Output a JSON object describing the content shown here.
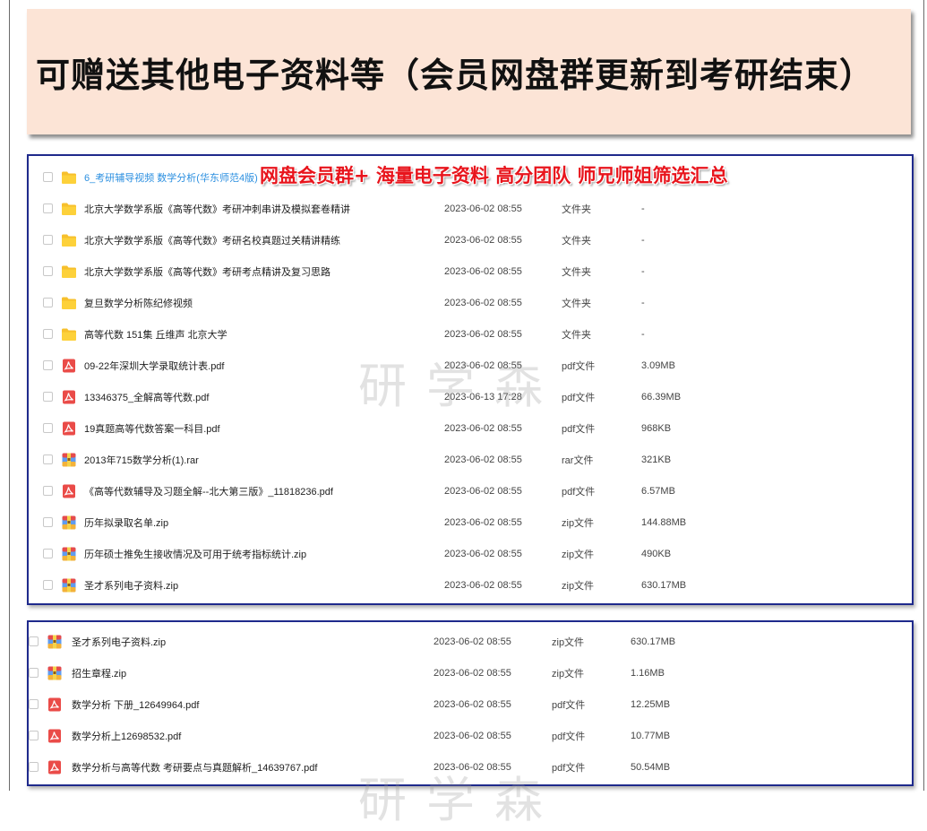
{
  "banner": {
    "title": "可赠送其他电子资料等（会员网盘群更新到考研结束）"
  },
  "overlay": {
    "promo": "网盘会员群+ 海量电子资料 高分团队 师兄师姐筛选汇总"
  },
  "watermark": {
    "text": "研学森"
  },
  "colors": {
    "panel_border": "#1f2a8c",
    "banner_bg": "#fce4d6",
    "promo_red": "#e8141c",
    "link_blue": "#2b8fe0"
  },
  "panel1": {
    "rows": [
      {
        "icon": "folder",
        "name": "6_考研辅导视频 数学分析(华东师范4版) 网",
        "date": "",
        "type": "",
        "size": ""
      },
      {
        "icon": "folder",
        "name": "北京大学数学系版《高等代数》考研冲刺串讲及模拟套卷精讲",
        "date": "2023-06-02 08:55",
        "type": "文件夹",
        "size": "-"
      },
      {
        "icon": "folder",
        "name": "北京大学数学系版《高等代数》考研名校真题过关精讲精练",
        "date": "2023-06-02 08:55",
        "type": "文件夹",
        "size": "-"
      },
      {
        "icon": "folder",
        "name": "北京大学数学系版《高等代数》考研考点精讲及复习思路",
        "date": "2023-06-02 08:55",
        "type": "文件夹",
        "size": "-"
      },
      {
        "icon": "folder",
        "name": "复旦数学分析陈纪修视频",
        "date": "2023-06-02 08:55",
        "type": "文件夹",
        "size": "-"
      },
      {
        "icon": "folder",
        "name": "高等代数 151集 丘维声 北京大学",
        "date": "2023-06-02 08:55",
        "type": "文件夹",
        "size": "-"
      },
      {
        "icon": "pdf",
        "name": "09-22年深圳大学录取统计表.pdf",
        "date": "2023-06-02 08:55",
        "type": "pdf文件",
        "size": "3.09MB"
      },
      {
        "icon": "pdf",
        "name": "13346375_全解高等代数.pdf",
        "date": "2023-06-13 17:28",
        "type": "pdf文件",
        "size": "66.39MB"
      },
      {
        "icon": "pdf",
        "name": "19真题高等代数答案一科目.pdf",
        "date": "2023-06-02 08:55",
        "type": "pdf文件",
        "size": "968KB"
      },
      {
        "icon": "zip",
        "name": "2013年715数学分析(1).rar",
        "date": "2023-06-02 08:55",
        "type": "rar文件",
        "size": "321KB"
      },
      {
        "icon": "pdf",
        "name": "《高等代数辅导及习题全解--北大第三版》_11818236.pdf",
        "date": "2023-06-02 08:55",
        "type": "pdf文件",
        "size": "6.57MB"
      },
      {
        "icon": "zip",
        "name": "历年拟录取名单.zip",
        "date": "2023-06-02 08:55",
        "type": "zip文件",
        "size": "144.88MB"
      },
      {
        "icon": "zip",
        "name": "历年硕士推免生接收情况及可用于统考指标统计.zip",
        "date": "2023-06-02 08:55",
        "type": "zip文件",
        "size": "490KB"
      },
      {
        "icon": "zip",
        "name": "圣才系列电子资料.zip",
        "date": "2023-06-02 08:55",
        "type": "zip文件",
        "size": "630.17MB"
      }
    ]
  },
  "panel2": {
    "rows": [
      {
        "icon": "zip",
        "name": "圣才系列电子资料.zip",
        "date": "2023-06-02 08:55",
        "type": "zip文件",
        "size": "630.17MB"
      },
      {
        "icon": "zip",
        "name": "招生章程.zip",
        "date": "2023-06-02 08:55",
        "type": "zip文件",
        "size": "1.16MB"
      },
      {
        "icon": "pdf",
        "name": "数学分析  下册_12649964.pdf",
        "date": "2023-06-02 08:55",
        "type": "pdf文件",
        "size": "12.25MB"
      },
      {
        "icon": "pdf",
        "name": "数学分析上12698532.pdf",
        "date": "2023-06-02 08:55",
        "type": "pdf文件",
        "size": "10.77MB"
      },
      {
        "icon": "pdf",
        "name": "数学分析与高等代数  考研要点与真题解析_14639767.pdf",
        "date": "2023-06-02 08:55",
        "type": "pdf文件",
        "size": "50.54MB"
      }
    ]
  }
}
